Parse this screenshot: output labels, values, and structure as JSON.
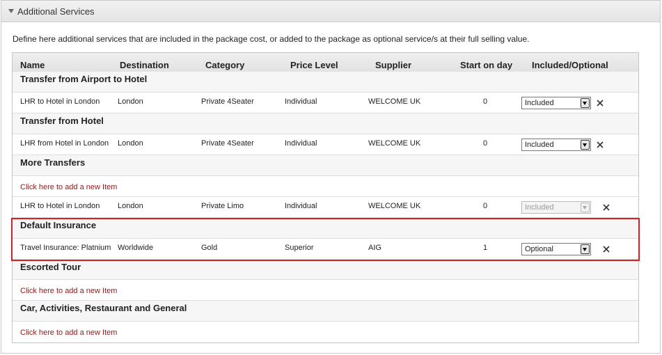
{
  "panel": {
    "title": "Additional Services",
    "description": "Define here additional services that are included in the package cost, or added to the package as optional service/s at their full selling value."
  },
  "table": {
    "columns": [
      "Name",
      "Destination",
      "Category",
      "Price Level",
      "Supplier",
      "Start on day",
      "Included/Optional"
    ],
    "add_item_label": "Click here to add a new Item",
    "groups": [
      {
        "title": "Transfer from Airport to Hotel",
        "rows": [
          {
            "name": "LHR to Hotel in London",
            "destination": "London",
            "category": "Private 4Seater",
            "price_level": "Individual",
            "supplier": "WELCOME UK",
            "start_day": "0",
            "status": "Included"
          }
        ]
      },
      {
        "title": "Transfer from Hotel",
        "rows": [
          {
            "name": "LHR from Hotel in London",
            "destination": "London",
            "category": "Private 4Seater",
            "price_level": "Individual",
            "supplier": "WELCOME UK",
            "start_day": "0",
            "status": "Included"
          }
        ]
      },
      {
        "title": "More Transfers",
        "rows": [
          {
            "name": "LHR to Hotel in London",
            "destination": "London",
            "category": "Private Limo",
            "price_level": "Individual",
            "supplier": "WELCOME UK",
            "start_day": "0",
            "status": "Included"
          }
        ]
      },
      {
        "title": "Default Insurance",
        "rows": [
          {
            "name": "Travel Insurance: Platnium",
            "destination": "Worldwide",
            "category": "Gold",
            "price_level": "Superior",
            "supplier": "AIG",
            "start_day": "1",
            "status": "Optional"
          }
        ]
      },
      {
        "title": "Escorted Tour"
      },
      {
        "title": "Car, Activities, Restaurant and General"
      }
    ]
  },
  "colors": {
    "link": "#8b1a1a",
    "highlight": "#d62020"
  }
}
